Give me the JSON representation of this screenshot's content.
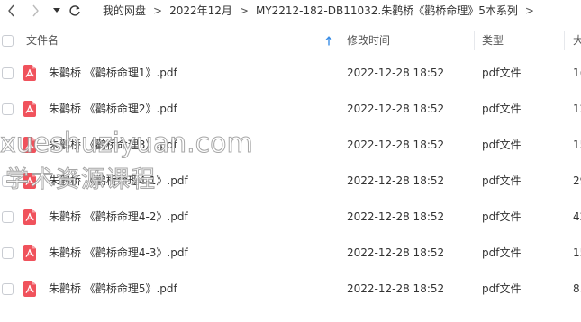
{
  "breadcrumb": [
    "我的网盘",
    "2022年12月",
    "MY2212-182-DB11032.朱鹳桥《鹳桥命理》5本系列"
  ],
  "columns": {
    "name": "文件名",
    "modified": "修改时间",
    "type": "类型",
    "size": "大"
  },
  "files": [
    {
      "name": "朱鹳桥 《鹳桥命理1》.pdf",
      "modified": "2022-12-28 18:52",
      "type": "pdf文件",
      "size": "1("
    },
    {
      "name": "朱鹳桥 《鹳桥命理2》.pdf",
      "modified": "2022-12-28 18:52",
      "type": "pdf文件",
      "size": "12"
    },
    {
      "name": "朱鹳桥 《鹳桥命理3》.pdf",
      "modified": "2022-12-28 18:52",
      "type": "pdf文件",
      "size": "15"
    },
    {
      "name": "朱鹳桥 《鹳桥命理4-1》.pdf",
      "modified": "2022-12-28 18:52",
      "type": "pdf文件",
      "size": "29"
    },
    {
      "name": "朱鹳桥 《鹳桥命理4-2》.pdf",
      "modified": "2022-12-28 18:52",
      "type": "pdf文件",
      "size": "42"
    },
    {
      "name": "朱鹳桥 《鹳桥命理4-3》.pdf",
      "modified": "2022-12-28 18:52",
      "type": "pdf文件",
      "size": "15"
    },
    {
      "name": "朱鹳桥 《鹳桥命理5》.pdf",
      "modified": "2022-12-28 18:52",
      "type": "pdf文件",
      "size": "8."
    }
  ],
  "watermark": {
    "line1": "xueshuziyuan.com",
    "line2": "学术资源课程"
  },
  "colors": {
    "pdf_icon": "#f0525c",
    "sort_arrow": "#3a8ee6",
    "divider": "#e6e8ec"
  }
}
